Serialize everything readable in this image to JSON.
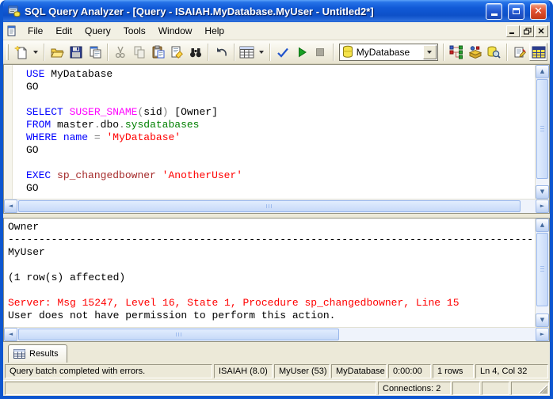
{
  "window": {
    "title": "SQL Query Analyzer - [Query - ISAIAH.MyDatabase.MyUser - Untitled2*]"
  },
  "menu": {
    "items": [
      "File",
      "Edit",
      "Query",
      "Tools",
      "Window",
      "Help"
    ]
  },
  "toolbar": {
    "database_combo": {
      "value": "MyDatabase"
    },
    "icon_names": [
      "new-query",
      "open",
      "save",
      "insert-template",
      "cut",
      "copy",
      "paste",
      "clear-window",
      "find",
      "undo",
      "execute-mode-grid",
      "parse-query",
      "execute-query",
      "cancel-query",
      "show-execution-plan",
      "object-browser",
      "object-search",
      "connection-properties",
      "show-results-pane"
    ]
  },
  "editor": {
    "colors": {
      "kw": "#0000FF",
      "fn": "#FF00FF",
      "tbl": "#008000",
      "str": "#FF0000",
      "sp": "#A52A2A",
      "op": "#808080",
      "txt": "#000000"
    },
    "lines": [
      [
        {
          "t": "USE",
          "c": "kw"
        },
        {
          "t": " MyDatabase",
          "c": "txt"
        }
      ],
      [
        {
          "t": "GO",
          "c": "txt"
        }
      ],
      [],
      [
        {
          "t": "SELECT",
          "c": "kw"
        },
        {
          "t": " ",
          "c": "txt"
        },
        {
          "t": "SUSER_SNAME",
          "c": "fn"
        },
        {
          "t": "(",
          "c": "op"
        },
        {
          "t": "sid",
          "c": "txt"
        },
        {
          "t": ")",
          "c": "op"
        },
        {
          "t": " [Owner]",
          "c": "txt"
        }
      ],
      [
        {
          "t": "FROM",
          "c": "kw"
        },
        {
          "t": " master",
          "c": "txt"
        },
        {
          "t": ".",
          "c": "op"
        },
        {
          "t": "dbo",
          "c": "txt"
        },
        {
          "t": ".",
          "c": "op"
        },
        {
          "t": "sysdatabases",
          "c": "tbl"
        }
      ],
      [
        {
          "t": "WHERE",
          "c": "kw"
        },
        {
          "t": " ",
          "c": "txt"
        },
        {
          "t": "name",
          "c": "kw"
        },
        {
          "t": " ",
          "c": "txt"
        },
        {
          "t": "=",
          "c": "op"
        },
        {
          "t": " ",
          "c": "txt"
        },
        {
          "t": "'MyDatabase'",
          "c": "str"
        }
      ],
      [
        {
          "t": "GO",
          "c": "txt"
        }
      ],
      [],
      [
        {
          "t": "EXEC",
          "c": "kw"
        },
        {
          "t": " ",
          "c": "txt"
        },
        {
          "t": "sp_changedbowner",
          "c": "sp"
        },
        {
          "t": " ",
          "c": "txt"
        },
        {
          "t": "'AnotherUser'",
          "c": "str"
        }
      ],
      [
        {
          "t": "GO",
          "c": "txt"
        }
      ]
    ]
  },
  "results": {
    "error_color": "#FF0000",
    "lines": [
      {
        "t": "Owner",
        "c": "txt"
      },
      {
        "t": "----------------------------------------------------------------------------------------------------",
        "c": "txt"
      },
      {
        "t": "MyUser",
        "c": "txt"
      },
      {
        "t": "",
        "c": "txt"
      },
      {
        "t": "(1 row(s) affected)",
        "c": "txt"
      },
      {
        "t": "",
        "c": "txt"
      },
      {
        "t": "Server: Msg 15247, Level 16, State 1, Procedure sp_changedbowner, Line 15",
        "c": "err"
      },
      {
        "t": "User does not have permission to perform this action.",
        "c": "txt"
      }
    ]
  },
  "tabs": {
    "results_label": "Results"
  },
  "query_statusbar": {
    "fields": [
      "Query batch completed with errors.",
      "ISAIAH (8.0)",
      "MyUser (53)",
      "MyDatabase",
      "0:00:00",
      "1 rows",
      "Ln 4, Col 32"
    ]
  },
  "app_statusbar": {
    "connections": "Connections: 2"
  }
}
